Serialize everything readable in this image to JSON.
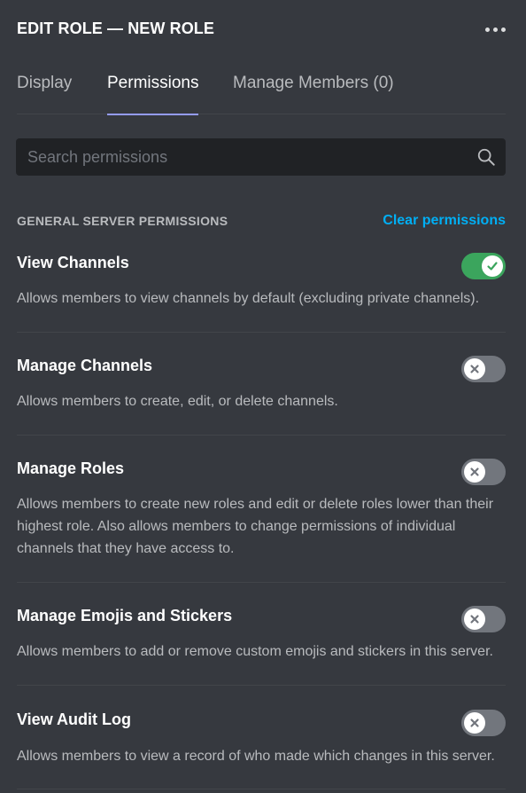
{
  "header": {
    "title": "EDIT ROLE — NEW ROLE",
    "more_icon": "more-horizontal-icon"
  },
  "tabs": [
    {
      "label": "Display",
      "active": false
    },
    {
      "label": "Permissions",
      "active": true
    },
    {
      "label": "Manage Members (0)",
      "active": false
    }
  ],
  "search": {
    "placeholder": "Search permissions",
    "value": "",
    "icon": "search-icon"
  },
  "section": {
    "title": "GENERAL SERVER PERMISSIONS",
    "clear_label": "Clear permissions"
  },
  "permissions": [
    {
      "name": "View Channels",
      "description": "Allows members to view channels by default (excluding private channels).",
      "enabled": true
    },
    {
      "name": "Manage Channels",
      "description": "Allows members to create, edit, or delete channels.",
      "enabled": false
    },
    {
      "name": "Manage Roles",
      "description": "Allows members to create new roles and edit or delete roles lower than their highest role. Also allows members to change permissions of individual channels that they have access to.",
      "enabled": false
    },
    {
      "name": "Manage Emojis and Stickers",
      "description": "Allows members to add or remove custom emojis and stickers in this server.",
      "enabled": false
    },
    {
      "name": "View Audit Log",
      "description": "Allows members to view a record of who made which changes in this server.",
      "enabled": false
    }
  ],
  "colors": {
    "background": "#36393f",
    "toggle_on": "#3ba55d",
    "toggle_off": "#72767d",
    "link": "#00aff4",
    "tab_indicator": "#949cf7"
  }
}
